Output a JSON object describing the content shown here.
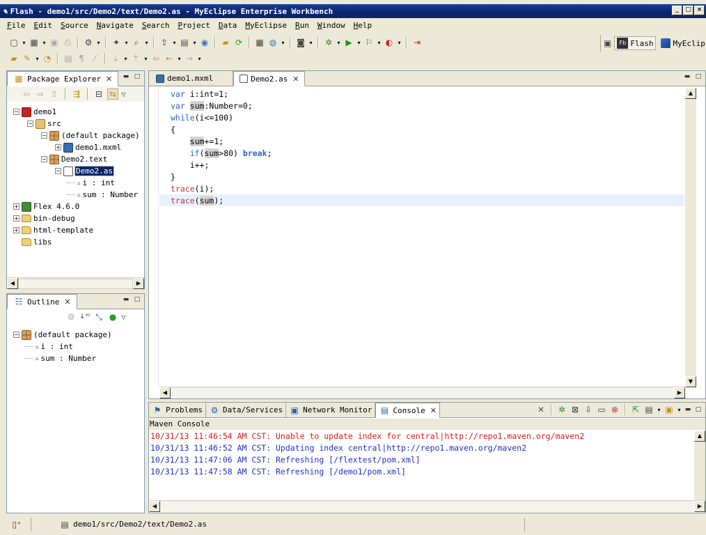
{
  "window": {
    "title": "Flash - demo1/src/Demo2/text/Demo2.as - MyEclipse Enterprise Workbench",
    "title_icon": "pen-icon"
  },
  "menu": [
    "File",
    "Edit",
    "Source",
    "Navigate",
    "Search",
    "Project",
    "Data",
    "MyEclipse",
    "Run",
    "Window",
    "Help"
  ],
  "perspectives": [
    {
      "label": "Flash",
      "icon": "flash-builder-icon",
      "badge": "Fb",
      "active": true
    },
    {
      "label": "MyEclips",
      "icon": "myeclipse-icon",
      "active": false
    }
  ],
  "package_explorer": {
    "title": "Package Explorer",
    "tree": [
      {
        "level": 0,
        "label": "demo1",
        "icon": "flex-project-icon",
        "expander": "−"
      },
      {
        "level": 1,
        "label": "src",
        "icon": "source-folder-icon",
        "expander": "−"
      },
      {
        "level": 2,
        "label": "(default package)",
        "icon": "package-icon",
        "expander": "−"
      },
      {
        "level": 3,
        "label": "demo1.mxml",
        "icon": "mxml-file-icon",
        "expander": "+"
      },
      {
        "level": 2,
        "label": "Demo2.text",
        "icon": "package-icon",
        "expander": "−"
      },
      {
        "level": 3,
        "label": "Demo2.as",
        "icon": "as-file-icon",
        "expander": "−",
        "selected": true
      },
      {
        "level": 4,
        "label": "i : int",
        "icon": "variable-icon",
        "expander": ""
      },
      {
        "level": 4,
        "label": "sum : Number",
        "icon": "variable-icon",
        "expander": ""
      },
      {
        "level": 0,
        "label": "Flex 4.6.0",
        "icon": "library-icon",
        "expander": "+"
      },
      {
        "level": 0,
        "label": "bin-debug",
        "icon": "folder-icon",
        "expander": "+"
      },
      {
        "level": 0,
        "label": "html-template",
        "icon": "folder-icon",
        "expander": "+"
      },
      {
        "level": 0,
        "label": "libs",
        "icon": "folder-icon",
        "expander": ""
      }
    ]
  },
  "outline": {
    "title": "Outline",
    "tree": [
      {
        "level": 0,
        "label": "(default package)",
        "icon": "package-icon",
        "expander": "−"
      },
      {
        "level": 1,
        "label": "i : int",
        "icon": "variable-icon",
        "expander": ""
      },
      {
        "level": 1,
        "label": "sum : Number",
        "icon": "variable-icon",
        "expander": ""
      }
    ]
  },
  "editor": {
    "tabs": [
      {
        "label": "demo1.mxml",
        "icon": "mxml-file-icon",
        "selected": false
      },
      {
        "label": "Demo2.as",
        "icon": "as-file-icon",
        "selected": true
      }
    ],
    "lines": [
      [
        {
          "t": "var ",
          "c": "kw"
        },
        {
          "t": "i:int=1;"
        }
      ],
      [
        {
          "t": "var ",
          "c": "kw"
        },
        {
          "t": "sum",
          "c": "hl"
        },
        {
          "t": ":Number=0;"
        }
      ],
      [
        {
          "t": "while",
          "c": "kw"
        },
        {
          "t": "(i<=100)"
        }
      ],
      [
        {
          "t": "{"
        }
      ],
      [
        {
          "t": "    "
        },
        {
          "t": "sum",
          "c": "hl"
        },
        {
          "t": "+=1;"
        }
      ],
      [
        {
          "t": "    "
        },
        {
          "t": "if",
          "c": "kw"
        },
        {
          "t": "("
        },
        {
          "t": "sum",
          "c": "hl"
        },
        {
          "t": ">80) "
        },
        {
          "t": "break",
          "c": "kwb"
        },
        {
          "t": ";"
        }
      ],
      [
        {
          "t": "    i++;"
        }
      ],
      [
        {
          "t": "}"
        }
      ],
      [
        {
          "t": "trace",
          "c": "fn"
        },
        {
          "t": "(i);"
        }
      ],
      [
        {
          "t": "trace",
          "c": "fn"
        },
        {
          "t": "("
        },
        {
          "t": "sum",
          "c": "hl"
        },
        {
          "t": ");"
        }
      ]
    ]
  },
  "bottom": {
    "tabs": [
      {
        "label": "Problems",
        "icon": "problems-icon",
        "selected": false
      },
      {
        "label": "Data/Services",
        "icon": "data-services-icon",
        "selected": false
      },
      {
        "label": "Network Monitor",
        "icon": "network-monitor-icon",
        "selected": false
      },
      {
        "label": "Console",
        "icon": "console-icon",
        "selected": true
      }
    ],
    "console_title": "Maven Console",
    "console_lines": [
      {
        "text": "10/31/13 11:46:54 AM CST: Unable to update index for central|http://repo1.maven.org/maven2",
        "color": "#e01818"
      },
      {
        "text": "10/31/13 11:46:52 AM CST: Updating index central|http://repo1.maven.org/maven2",
        "color": "#2030c8"
      },
      {
        "text": "10/31/13 11:47:06 AM CST: Refreshing [/flextest/pom.xml]",
        "color": "#2030c8"
      },
      {
        "text": "10/31/13 11:47:58 AM CST: Refreshing [/demo1/pom.xml]",
        "color": "#2030c8"
      }
    ]
  },
  "status": {
    "path": "demo1/src/Demo2/text/Demo2.as"
  }
}
